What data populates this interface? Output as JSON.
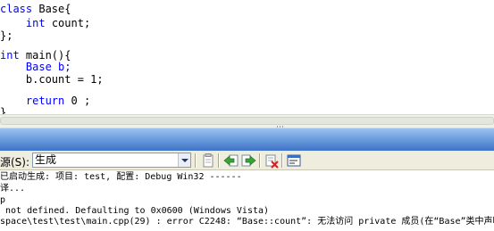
{
  "editor": {
    "lines": [
      {
        "kw": "class",
        "rest": " Base{"
      },
      {
        "indent": "    ",
        "kw": "int",
        "rest": " count;"
      },
      {
        "kw": "",
        "rest": "};"
      },
      {
        "kw": "",
        "rest": ""
      },
      {
        "kw": "int",
        "rest": " main(){"
      },
      {
        "indent": "    ",
        "kw": "",
        "rest": "Base b;"
      },
      {
        "indent": "    ",
        "kw": "",
        "rest": "b.count = 1;"
      },
      {
        "kw": "",
        "rest": ""
      },
      {
        "indent": "    ",
        "kw": "return",
        "rest": " 0 ;"
      },
      {
        "kw": "",
        "rest": "}"
      }
    ]
  },
  "toolbar": {
    "source_label": "源(S):",
    "source_value": "生成",
    "icons": [
      "clipboard-icon",
      "go-previous-icon",
      "go-next-icon",
      "clear-all-icon",
      "toggle-wrap-icon"
    ]
  },
  "output": {
    "lines": [
      "已启动生成: 项目: test, 配置: Debug Win32 ------",
      "译...",
      "p",
      " not defined. Defaulting to 0x0600 (Windows Vista)",
      "space\\test\\test\\main.cpp(29) : error C2248: “Base::count”: 无法访问 private 成员(在“Base”类中声明)"
    ]
  },
  "colors": {
    "keyword": "#0000ff",
    "splitter_top": "#9ec2ee",
    "splitter_bottom": "#3e73c8",
    "toolbar_bg": "#efedde"
  }
}
